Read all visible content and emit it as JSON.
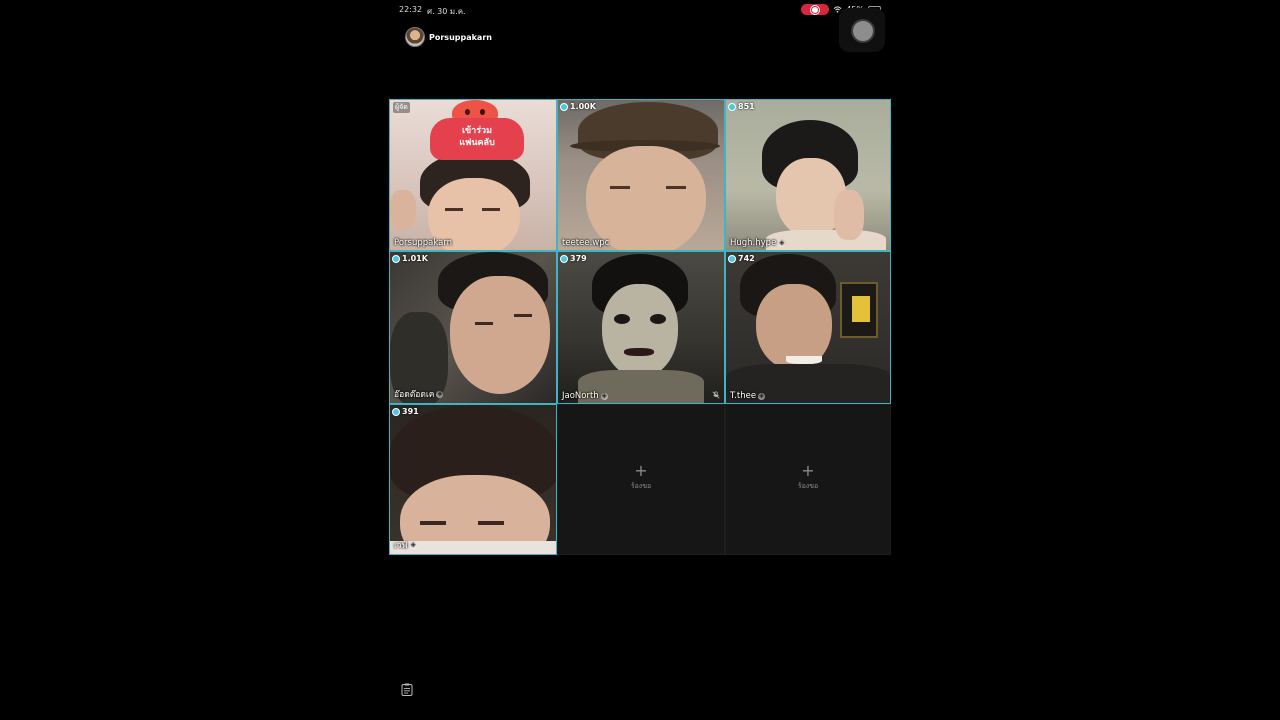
{
  "status_bar": {
    "time": "22:32",
    "date": "ศ. 30 ม.ค.",
    "battery": "45%",
    "battery_level": 0.45
  },
  "host": {
    "name": "Porsuppakarn"
  },
  "sticker": {
    "line1": "เข้าร่วม",
    "line2": "แฟนคลับ"
  },
  "tiles": [
    {
      "host_tag": "ผู้จัด",
      "name": "Porsuppakarn",
      "viewers": ""
    },
    {
      "viewers": "1.00K",
      "name": "teetee.wpc"
    },
    {
      "viewers": "851",
      "name": "Hugh.hype"
    },
    {
      "viewers": "1.01K",
      "name": "อ๊อดต๊อดเค"
    },
    {
      "viewers": "379",
      "name": "JaoNorth"
    },
    {
      "viewers": "742",
      "name": "T.thee"
    },
    {
      "viewers": "391",
      "name": "เวฟ"
    }
  ],
  "empty_slots": [
    {
      "plus": "+",
      "label": "ร้องขอ"
    },
    {
      "plus": "+",
      "label": "ร้องขอ"
    }
  ],
  "colors": {
    "accent": "#3fb4c4",
    "record": "#d7263d",
    "background": "#000000"
  },
  "icons": {
    "follow": "plus-circle-icon",
    "mic": "mic-off-icon",
    "bottom": "clipboard-icon",
    "viewer": "viewer-icon"
  }
}
